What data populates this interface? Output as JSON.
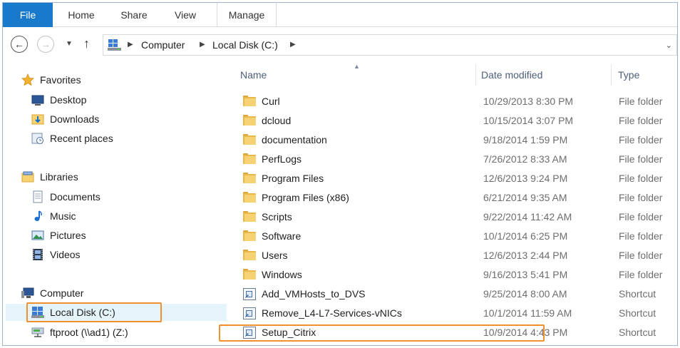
{
  "ribbon": {
    "tabs": [
      "File",
      "Home",
      "Share",
      "View",
      "Manage"
    ]
  },
  "address": {
    "crumbs": [
      "Computer",
      "Local Disk (C:)"
    ]
  },
  "navpane": {
    "favorites": {
      "label": "Favorites",
      "items": [
        "Desktop",
        "Downloads",
        "Recent places"
      ]
    },
    "libraries": {
      "label": "Libraries",
      "items": [
        "Documents",
        "Music",
        "Pictures",
        "Videos"
      ]
    },
    "computer": {
      "label": "Computer",
      "items": [
        "Local Disk (C:)",
        "ftproot (\\\\ad1) (Z:)"
      ]
    }
  },
  "columns": {
    "name": "Name",
    "date": "Date modified",
    "type": "Type"
  },
  "files": [
    {
      "name": "Curl",
      "date": "10/29/2013 8:30 PM",
      "type": "File folder",
      "icon": "folder"
    },
    {
      "name": "dcloud",
      "date": "10/15/2014 3:07 PM",
      "type": "File folder",
      "icon": "folder"
    },
    {
      "name": "documentation",
      "date": "9/18/2014 1:59 PM",
      "type": "File folder",
      "icon": "folder"
    },
    {
      "name": "PerfLogs",
      "date": "7/26/2012 8:33 AM",
      "type": "File folder",
      "icon": "folder"
    },
    {
      "name": "Program Files",
      "date": "12/6/2013 9:24 PM",
      "type": "File folder",
      "icon": "folder"
    },
    {
      "name": "Program Files (x86)",
      "date": "6/21/2014 9:35 AM",
      "type": "File folder",
      "icon": "folder"
    },
    {
      "name": "Scripts",
      "date": "9/22/2014 11:42 AM",
      "type": "File folder",
      "icon": "folder"
    },
    {
      "name": "Software",
      "date": "10/1/2014 6:25 PM",
      "type": "File folder",
      "icon": "folder"
    },
    {
      "name": "Users",
      "date": "12/6/2013 2:44 PM",
      "type": "File folder",
      "icon": "folder"
    },
    {
      "name": "Windows",
      "date": "9/16/2013 5:41 PM",
      "type": "File folder",
      "icon": "folder"
    },
    {
      "name": "Add_VMHosts_to_DVS",
      "date": "9/25/2014 8:00 AM",
      "type": "Shortcut",
      "icon": "shortcut"
    },
    {
      "name": "Remove_L4-L7-Services-vNICs",
      "date": "10/1/2014 11:59 AM",
      "type": "Shortcut",
      "icon": "shortcut"
    },
    {
      "name": "Setup_Citrix",
      "date": "10/9/2014 4:43 PM",
      "type": "Shortcut",
      "icon": "shortcut"
    }
  ],
  "colors": {
    "file_tab": "#1979ca",
    "highlight": "#f0902e",
    "selection": "#e5f3fb"
  }
}
